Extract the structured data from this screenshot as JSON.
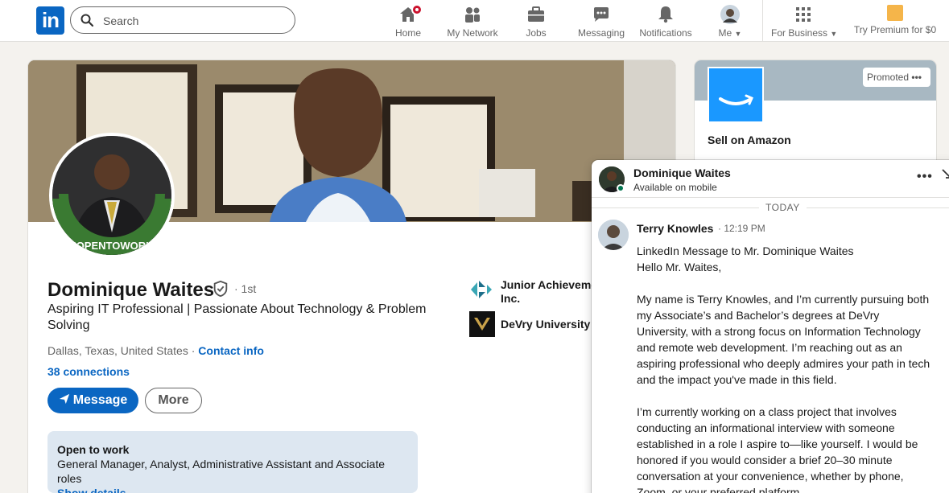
{
  "nav": {
    "logo": "in",
    "search_placeholder": "Search",
    "items": [
      {
        "label": "Home"
      },
      {
        "label": "My Network"
      },
      {
        "label": "Jobs"
      },
      {
        "label": "Messaging"
      },
      {
        "label": "Notifications"
      },
      {
        "label": "Me"
      },
      {
        "label": "For Business"
      },
      {
        "label": "Try Premium for $0"
      }
    ]
  },
  "profile": {
    "name": "Dominique Waites",
    "degree": "· 1st",
    "headline": "Aspiring IT Professional | Passionate About Technology & Problem Solving",
    "location": "Dallas, Texas, United States",
    "location_sep": " · ",
    "contact_info": "Contact info",
    "connections": "38 connections",
    "message_button": "Message",
    "more_button": "More",
    "open_to_work": {
      "title": "Open to work",
      "roles": "General Manager, Analyst, Administrative Assistant and Associate roles",
      "show_details": "Show details"
    },
    "avatar_frame_text": "#OPENTOWORK",
    "experience": [
      {
        "name": "Junior Achievement Inc."
      },
      {
        "name": "DeVry University"
      }
    ]
  },
  "ad": {
    "promoted": "Promoted",
    "title": "Sell on Amazon"
  },
  "messaging": {
    "contact_name": "Dominique Waites",
    "contact_status": "Available on mobile",
    "divider": "TODAY",
    "sender_name": "Terry Knowles",
    "sender_time": "· 12:19 PM",
    "paragraphs": [
      "LinkedIn Message to Mr. Dominique Waites",
      "Hello Mr. Waites,",
      "",
      "My name is Terry Knowles, and I’m currently pursuing both my Associate’s and Bachelor’s degrees at DeVry University, with a strong focus on Information Technology and remote web development. I’m reaching out as an aspiring professional who deeply admires your path in tech and the impact you've made in this field.",
      "",
      "I’m currently working on a class project that involves conducting an informational interview with someone established in a role I aspire to—like yourself. I would be honored if you would consider a brief 20–30 minute conversation at your convenience, whether by phone, Zoom, or your preferred platform."
    ]
  },
  "colors": {
    "linkedin_blue": "#0a66c2",
    "open_to_work_bg": "#dde7f1",
    "open_to_work_green": "#3a7a32",
    "notification_red": "#cb112d",
    "online_green": "#01754f"
  }
}
